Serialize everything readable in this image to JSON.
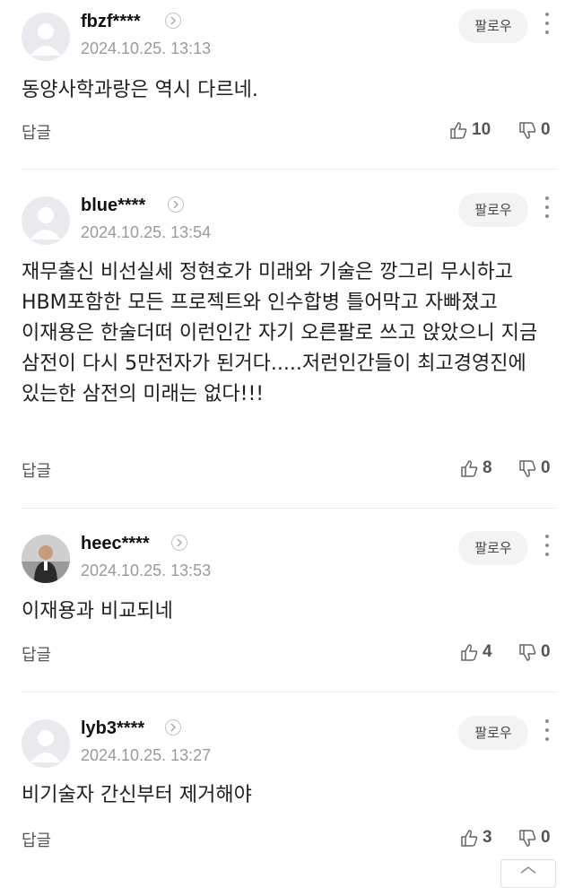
{
  "comments": [
    {
      "username": "fbzf****",
      "date": "2024.10.25. 13:13",
      "follow": "팔로우",
      "text": "동양사학과랑은 역시 다르네.",
      "reply": "답글",
      "likes": "10",
      "dislikes": "0",
      "avatar": "default-avatar"
    },
    {
      "username": "blue****",
      "date": "2024.10.25. 13:54",
      "follow": "팔로우",
      "text": "재무출신 비선실세 정현호가 미래와 기술은 깡그리 무시하고 HBM포함한 모든 프로젝트와 인수합병 틀어막고 자빠졌고 이재용은 한술더떠 이런인간 자기 오른팔로 쓰고 앉았으니 지금 삼전이 다시 5만전자가 된거다.....저런인간들이 최고경영진에 있는한 삼전의 미래는 없다!!!",
      "reply": "답글",
      "likes": "8",
      "dislikes": "0",
      "avatar": "default-avatar"
    },
    {
      "username": "heec****",
      "date": "2024.10.25. 13:53",
      "follow": "팔로우",
      "text": "이재용과 비교되네",
      "reply": "답글",
      "likes": "4",
      "dislikes": "0",
      "avatar": "photo-avatar"
    },
    {
      "username": "lyb3****",
      "date": "2024.10.25. 13:27",
      "follow": "팔로우",
      "text": "비기술자 간신부터 제거해야",
      "reply": "답글",
      "likes": "3",
      "dislikes": "0",
      "avatar": "default-avatar"
    }
  ],
  "icons": {
    "like": "thumbs-up-icon",
    "dislike": "thumbs-down-icon",
    "more": "more-vertical-icon",
    "profile": "chevron-right-icon",
    "scroll_top": "arrow-up-icon"
  },
  "colors": {
    "date": "#9a9a9a",
    "follow_bg": "#f3f3f3",
    "separator": "#ececec"
  }
}
